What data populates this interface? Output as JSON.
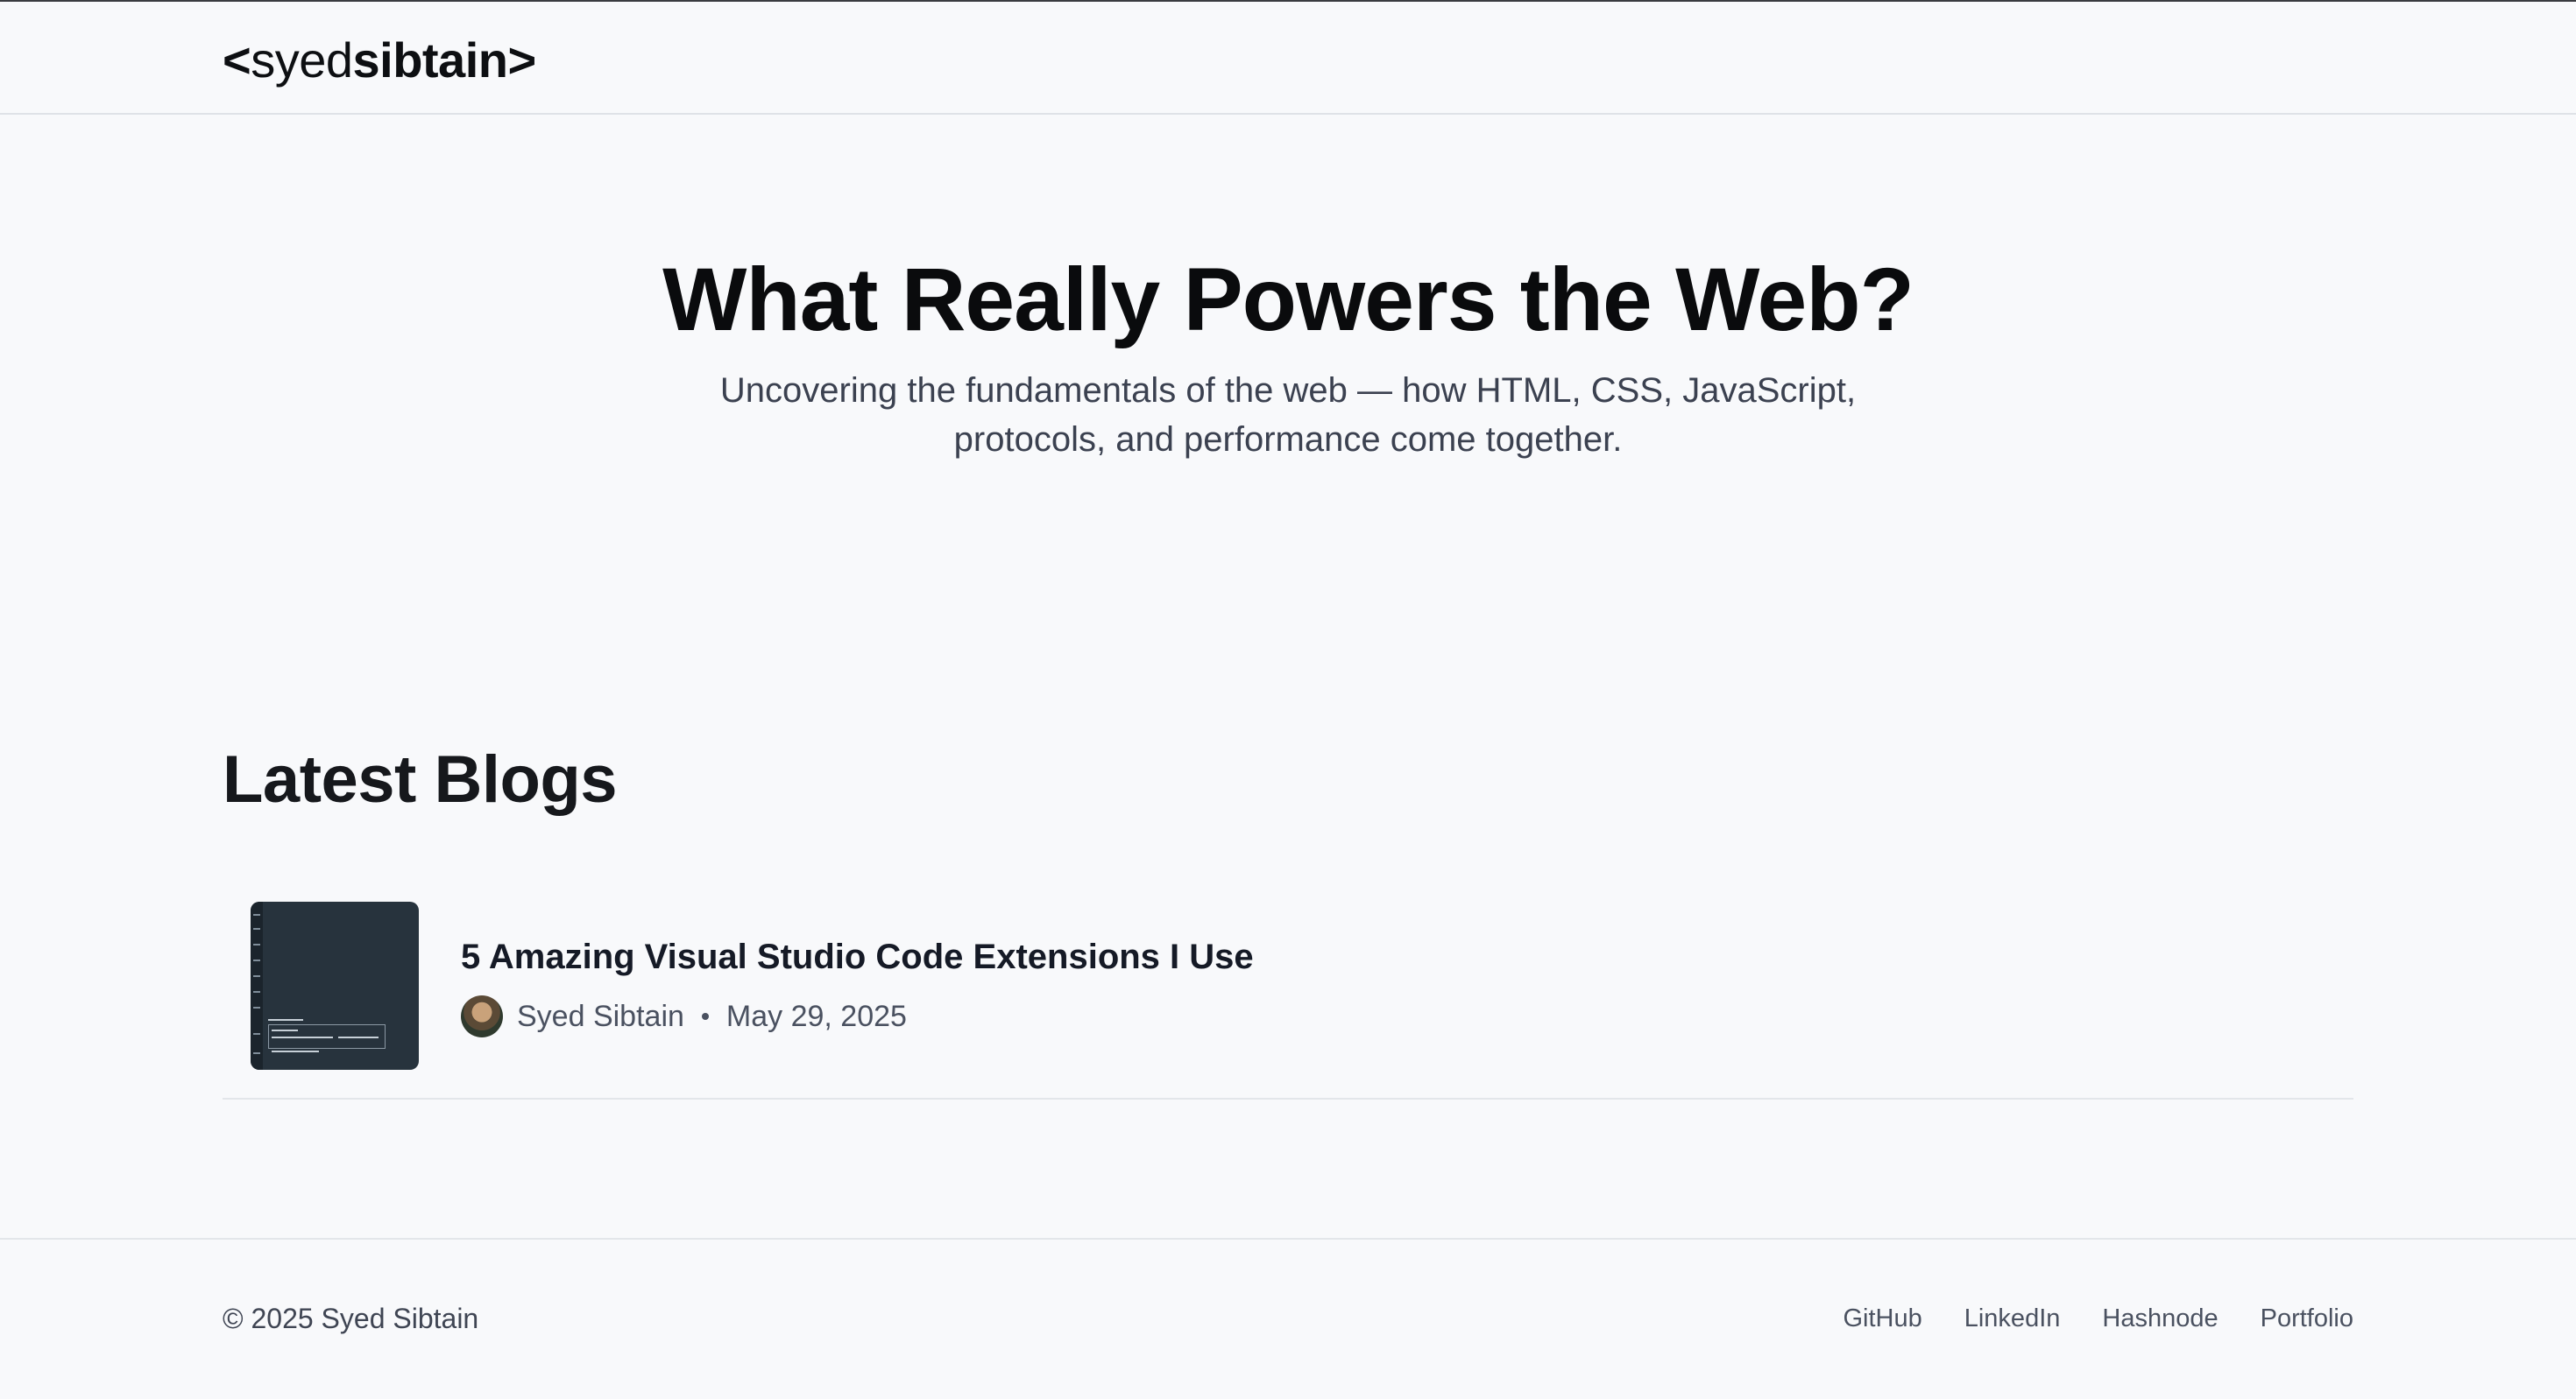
{
  "header": {
    "logo": {
      "open": "<",
      "light": "syed",
      "bold": "sibtain",
      "close": ">"
    }
  },
  "hero": {
    "title": "What Really Powers the Web?",
    "subtitle": "Uncovering the fundamentals of the web — how HTML, CSS, JavaScript, protocols, and performance come together."
  },
  "blogs": {
    "heading": "Latest Blogs",
    "posts": [
      {
        "title": "5 Amazing Visual Studio Code Extensions I Use",
        "author": "Syed Sibtain",
        "date": "May 29, 2025",
        "thumbnail_icon": "code-editor-screenshot"
      }
    ]
  },
  "footer": {
    "copyright": "© 2025 Syed Sibtain",
    "links": [
      "GitHub",
      "LinkedIn",
      "Hashnode",
      "Portfolio"
    ]
  },
  "colors": {
    "background": "#f8f9fb",
    "text": "#111318",
    "muted": "#4a5160",
    "thumbnail": "#27333d",
    "divider": "#e3e6ea"
  }
}
